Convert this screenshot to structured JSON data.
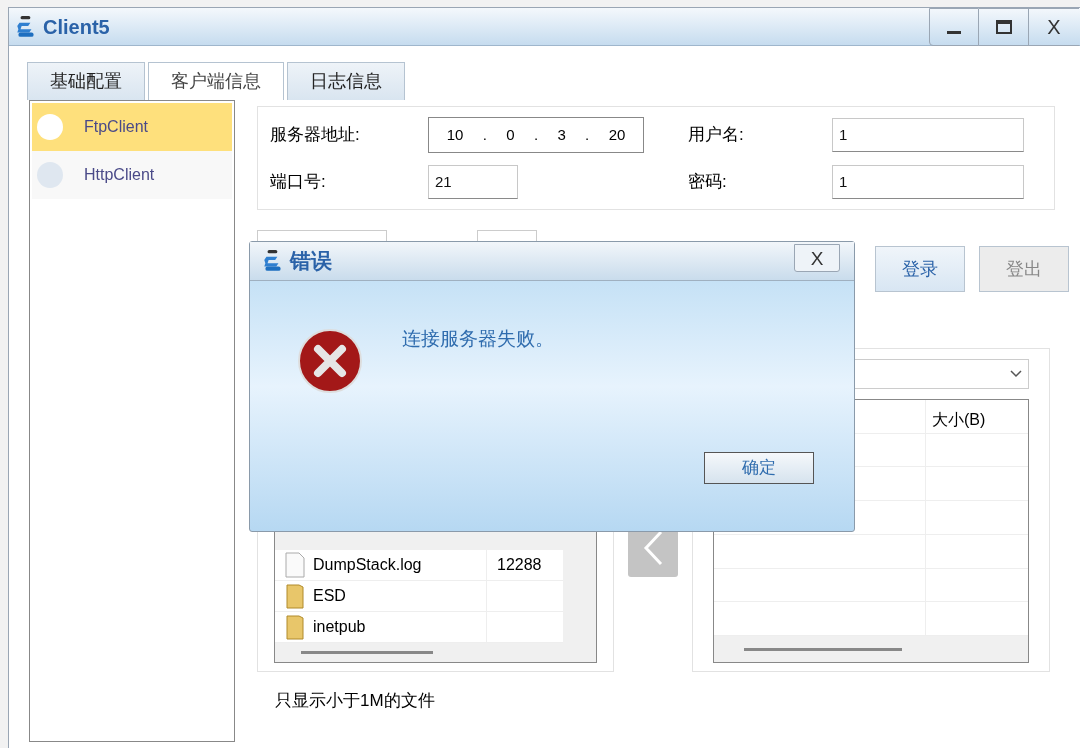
{
  "window": {
    "title": "Client5",
    "close_label": "X"
  },
  "tabs": [
    {
      "label": "基础配置",
      "selected": false
    },
    {
      "label": "客户端信息",
      "selected": true
    },
    {
      "label": "日志信息",
      "selected": false
    }
  ],
  "clients": [
    {
      "name": "FtpClient",
      "selected": true
    },
    {
      "name": "HttpClient",
      "selected": false
    }
  ],
  "form": {
    "server_address_label": "服务器地址:",
    "ip_parts": [
      "10",
      ".",
      "0",
      ".",
      "3",
      ".",
      "20"
    ],
    "port_label": "端口号:",
    "port": "21",
    "username_label": "用户名:",
    "username": "1",
    "password_label": "密码:",
    "password": "1"
  },
  "sub_tabs": [
    {
      "kind": "tab"
    },
    {
      "kind": "tab"
    }
  ],
  "buttons": [
    {
      "label": "登录",
      "disabled": false
    },
    {
      "label": "登出",
      "disabled": true
    }
  ],
  "local_files": {
    "rows": [
      {
        "kind": "file",
        "name": "DumpStack.log",
        "size": "12288"
      },
      {
        "kind": "folder",
        "name": "ESD"
      },
      {
        "kind": "folder",
        "name": "inetpub"
      }
    ]
  },
  "remote_files": {
    "size_column": "大小(B)"
  },
  "note": "只显示小于1M的文件",
  "dialog": {
    "title": "错误",
    "message": "连接服务器失败。",
    "ok_label": "确定",
    "close_label": "X"
  }
}
